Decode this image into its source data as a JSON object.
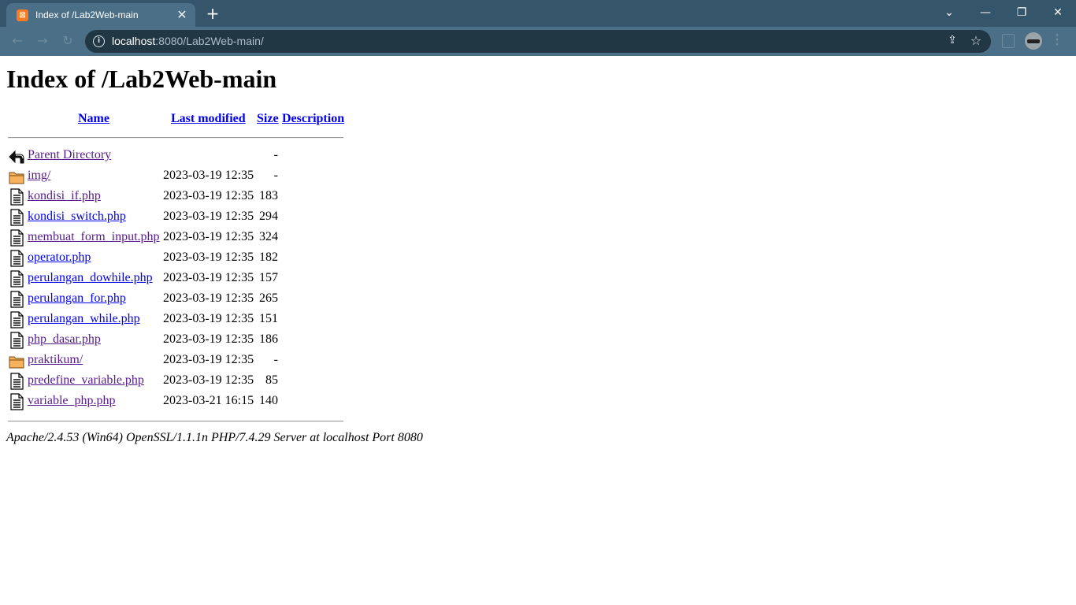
{
  "browser": {
    "tab_title": "Index of /Lab2Web-main",
    "favicon_label": "⊠",
    "url_host": "localhost",
    "url_rest": ":8080/Lab2Web-main/"
  },
  "page": {
    "heading": "Index of /Lab2Web-main",
    "columns": {
      "name": "Name",
      "last_modified": "Last modified",
      "size": "Size",
      "description": "Description"
    },
    "rows": [
      {
        "name": "Parent Directory",
        "modified": "",
        "size": "-",
        "icon": "back-arrow-icon",
        "visited": true
      },
      {
        "name": "img/",
        "modified": "2023-03-19 12:35",
        "size": "-",
        "icon": "folder-icon",
        "visited": true
      },
      {
        "name": "kondisi_if.php",
        "modified": "2023-03-19 12:35",
        "size": "183",
        "icon": "file-icon",
        "visited": true
      },
      {
        "name": "kondisi_switch.php",
        "modified": "2023-03-19 12:35",
        "size": "294",
        "icon": "file-icon",
        "visited": false
      },
      {
        "name": "membuat_form_input.php",
        "modified": "2023-03-19 12:35",
        "size": "324",
        "icon": "file-icon",
        "visited": true
      },
      {
        "name": "operator.php",
        "modified": "2023-03-19 12:35",
        "size": "182",
        "icon": "file-icon",
        "visited": false
      },
      {
        "name": "perulangan_dowhile.php",
        "modified": "2023-03-19 12:35",
        "size": "157",
        "icon": "file-icon",
        "visited": false
      },
      {
        "name": "perulangan_for.php",
        "modified": "2023-03-19 12:35",
        "size": "265",
        "icon": "file-icon",
        "visited": false
      },
      {
        "name": "perulangan_while.php",
        "modified": "2023-03-19 12:35",
        "size": "151",
        "icon": "file-icon",
        "visited": false
      },
      {
        "name": "php_dasar.php",
        "modified": "2023-03-19 12:35",
        "size": "186",
        "icon": "file-icon",
        "visited": true
      },
      {
        "name": "praktikum/",
        "modified": "2023-03-19 12:35",
        "size": "-",
        "icon": "folder-icon",
        "visited": true
      },
      {
        "name": "predefine_variable.php",
        "modified": "2023-03-19 12:35",
        "size": "85",
        "icon": "file-icon",
        "visited": true
      },
      {
        "name": "variable_php.php",
        "modified": "2023-03-21 16:15",
        "size": "140",
        "icon": "file-icon",
        "visited": true
      }
    ],
    "footer": "Apache/2.4.53 (Win64) OpenSSL/1.1.1n PHP/7.4.29 Server at localhost Port 8080"
  },
  "colors": {
    "link": "#0000ee",
    "visited_link": "#551a8b",
    "tab_strip": "#35566a",
    "toolbar": "#4b6f86",
    "omnibox": "#223744",
    "favicon": "#fb7a24"
  }
}
